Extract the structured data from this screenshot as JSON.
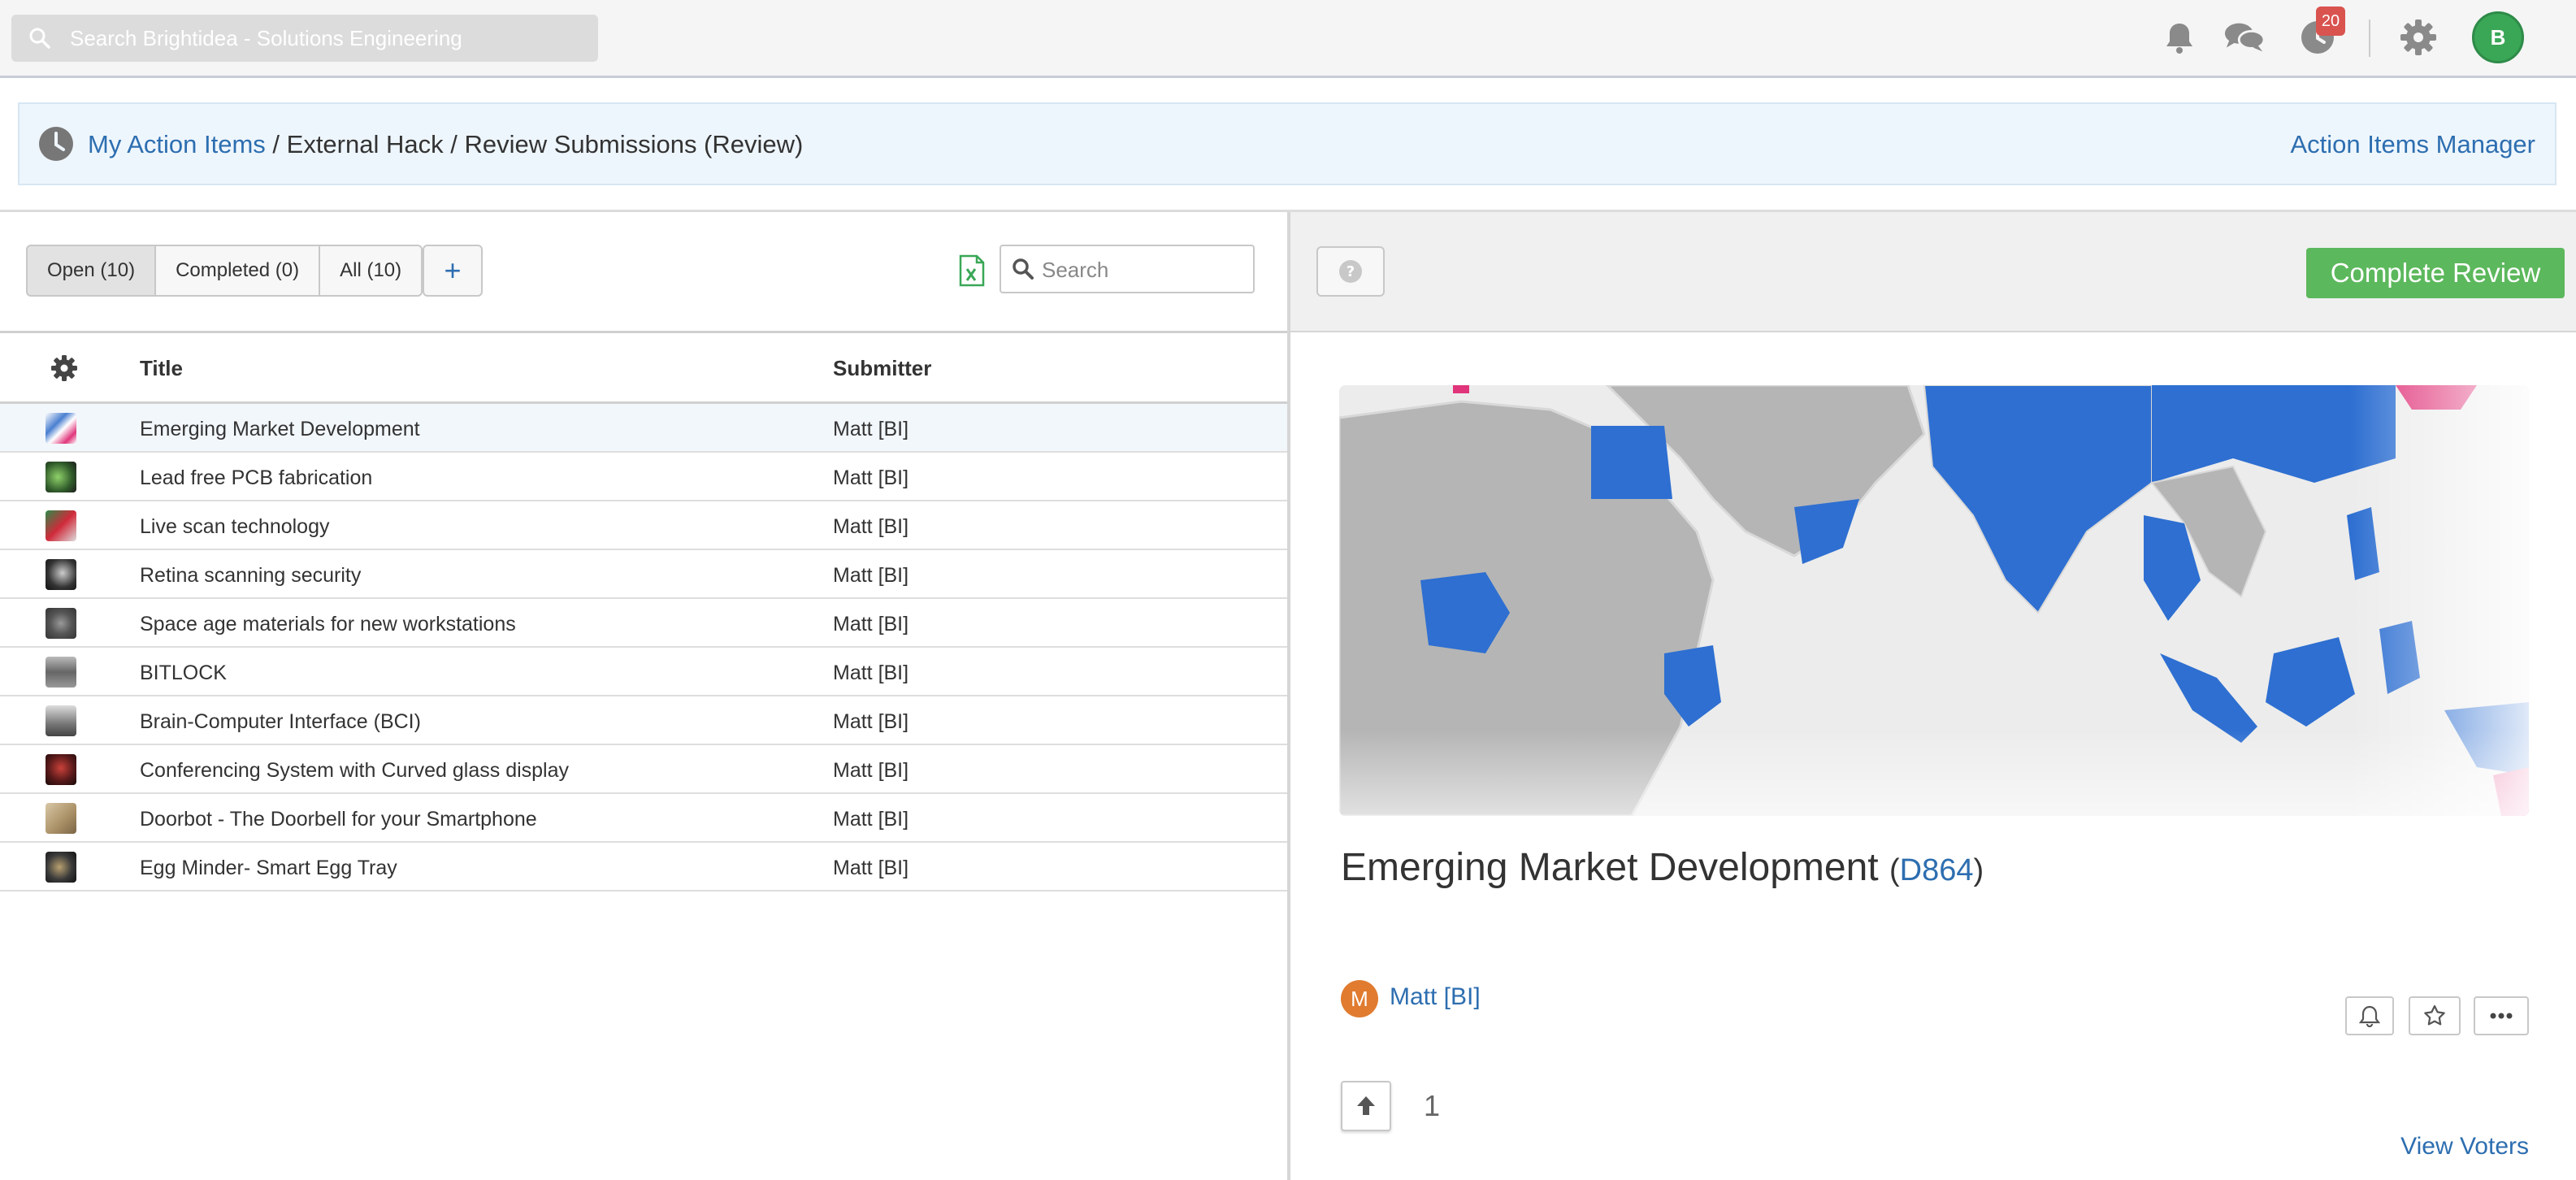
{
  "topbar": {
    "search_placeholder": "Search Brightidea - Solutions Engineering",
    "notifications_badge": "20",
    "avatar_initial": "B",
    "icons": [
      "bell-icon",
      "chat-icon",
      "clock-icon",
      "gear-icon"
    ]
  },
  "breadcrumb": {
    "root": "My Action Items",
    "sep1": " / ",
    "program": "External Hack",
    "sep2": " / ",
    "page": "Review Submissions (Review)",
    "manager_link": "Action Items Manager"
  },
  "list": {
    "filters": [
      "Open (10)",
      "Completed (0)",
      "All (10)"
    ],
    "add_label": "+",
    "search_placeholder": "Search",
    "columns": {
      "title": "Title",
      "submitter": "Submitter"
    },
    "rows": [
      {
        "title": "Emerging Market Development",
        "submitter": "Matt [BI]"
      },
      {
        "title": "Lead free PCB fabrication",
        "submitter": "Matt [BI]"
      },
      {
        "title": "Live scan technology",
        "submitter": "Matt [BI]"
      },
      {
        "title": "Retina scanning security",
        "submitter": "Matt [BI]"
      },
      {
        "title": "Space age materials for new workstations",
        "submitter": "Matt [BI]"
      },
      {
        "title": "BITLOCK",
        "submitter": "Matt [BI]"
      },
      {
        "title": "Brain-Computer Interface (BCI)",
        "submitter": "Matt [BI]"
      },
      {
        "title": "Conferencing System with Curved glass display",
        "submitter": "Matt [BI]"
      },
      {
        "title": "Doorbot - The Doorbell for your Smartphone",
        "submitter": "Matt [BI]"
      },
      {
        "title": "Egg Minder- Smart Egg Tray",
        "submitter": "Matt [BI]"
      }
    ]
  },
  "detail": {
    "complete_button": "Complete Review",
    "title": "Emerging Market Development",
    "code_open": "(",
    "code": "D864",
    "code_close": ")",
    "submitter_initial": "M",
    "submitter": "Matt [BI]",
    "vote_count": "1",
    "view_voters": "View Voters"
  },
  "colors": {
    "accent": "#2d6eb0",
    "complete": "#5cb85c",
    "badge": "#d9534f",
    "avatar": "#3aa757",
    "submitter_avatar": "#e07b2f"
  }
}
